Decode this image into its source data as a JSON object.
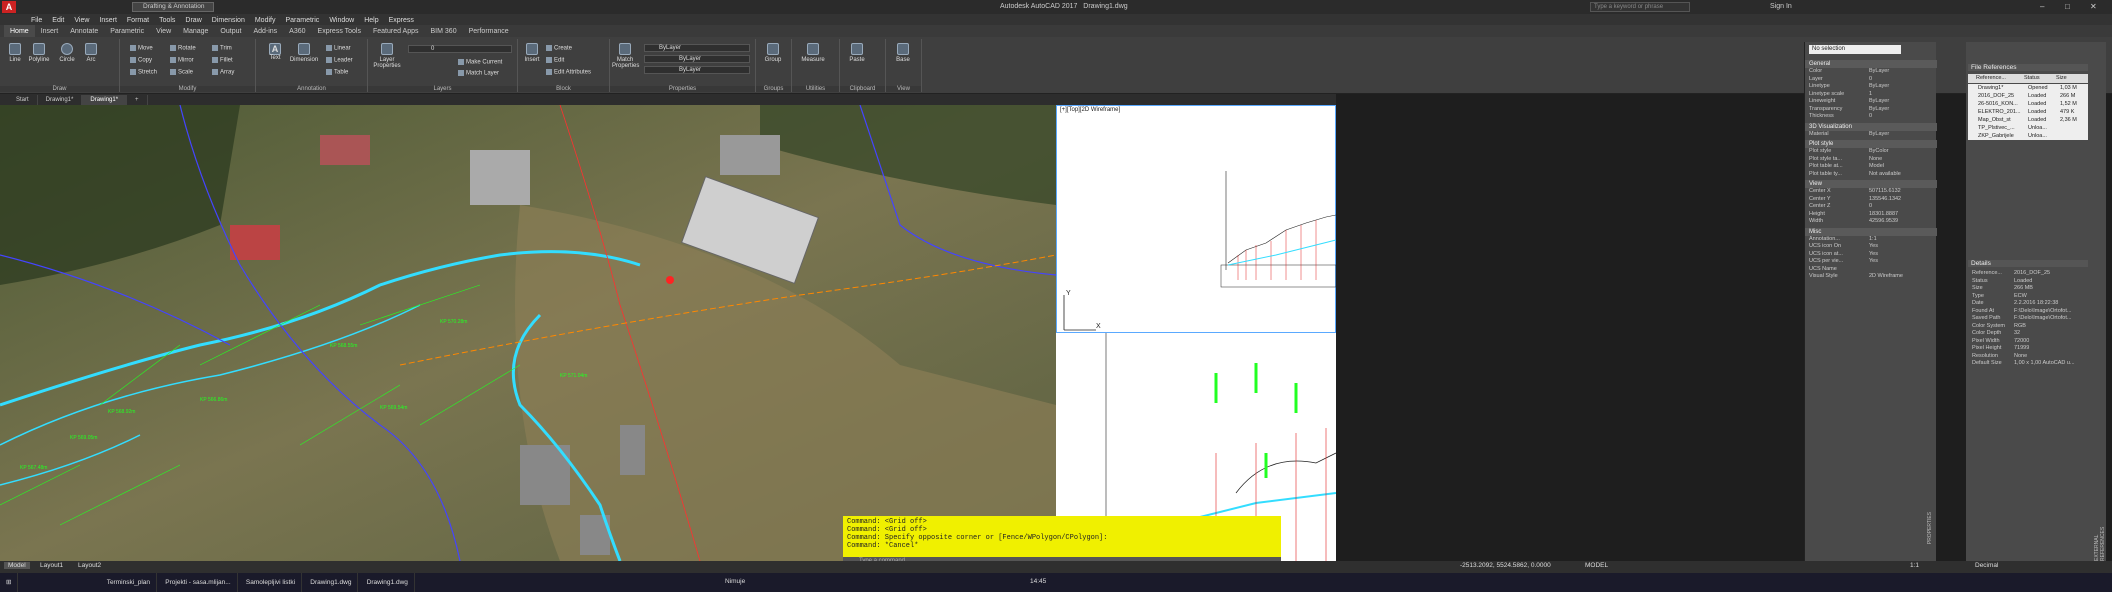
{
  "window": {
    "app_title": "Autodesk AutoCAD 2017",
    "doc_title": "Drawing1.dwg",
    "workspace": "Drafting & Annotation",
    "search_placeholder": "Type a keyword or phrase",
    "sign_in": "Sign In"
  },
  "menu": [
    "File",
    "Edit",
    "View",
    "Insert",
    "Format",
    "Tools",
    "Draw",
    "Dimension",
    "Modify",
    "Parametric",
    "Window",
    "Help",
    "Express"
  ],
  "ribbon_tabs": [
    "Home",
    "Insert",
    "Annotate",
    "Parametric",
    "View",
    "Manage",
    "Output",
    "Add-ins",
    "A360",
    "Express Tools",
    "Featured Apps",
    "BIM 360",
    "Performance"
  ],
  "ribbon": {
    "draw": {
      "label": "Draw",
      "buttons": [
        "Line",
        "Polyline",
        "Circle",
        "Arc"
      ]
    },
    "modify": {
      "label": "Modify",
      "buttons": [
        "Move",
        "Rotate",
        "Trim",
        "Copy",
        "Mirror",
        "Fillet",
        "Stretch",
        "Scale",
        "Array"
      ]
    },
    "annotation": {
      "label": "Annotation",
      "buttons": [
        "Text",
        "Dimension",
        "Linear",
        "Leader",
        "Table"
      ]
    },
    "layers": {
      "label": "Layers",
      "buttons": [
        "Layer Properties",
        "Make Current",
        "Match Layer"
      ],
      "layer_value": "0"
    },
    "block": {
      "label": "Block",
      "buttons": [
        "Insert",
        "Create",
        "Edit",
        "Edit Attributes"
      ]
    },
    "properties": {
      "label": "Properties",
      "buttons": [
        "Match Properties"
      ],
      "color": "ByLayer",
      "linetype": "ByLayer",
      "lineweight": "ByLayer"
    },
    "groups": {
      "label": "Groups",
      "buttons": [
        "Group"
      ]
    },
    "utilities": {
      "label": "Utilities",
      "buttons": [
        "Measure"
      ]
    },
    "clipboard": {
      "label": "Clipboard",
      "buttons": [
        "Paste"
      ]
    },
    "view": {
      "label": "View",
      "buttons": [
        "Base"
      ]
    }
  },
  "doc_tabs": [
    "Start",
    "Drawing1*",
    "Drawing1*"
  ],
  "viewport_label": "[+][Top][2D Wireframe]",
  "map_labels": [
    "KP 568.92m",
    "KP 569.05m",
    "KP 567.48m",
    "KP 566.86m",
    "KP 568.55m",
    "KP 570.28m",
    "KP 571.04m",
    "KP 569.54m"
  ],
  "command_lines": [
    "Command:  <Grid off>",
    "Command:  <Grid off>",
    "Command: Specify opposite corner or [Fence/WPolygon/CPolygon]:",
    "Command: *Cancel*"
  ],
  "command_placeholder": "Type a command",
  "properties_panel": {
    "selection": "No selection",
    "sections": [
      {
        "title": "General",
        "rows": [
          [
            "Color",
            "ByLayer"
          ],
          [
            "Layer",
            "0"
          ],
          [
            "Linetype",
            "ByLayer"
          ],
          [
            "Linetype scale",
            "1"
          ],
          [
            "Lineweight",
            "ByLayer"
          ],
          [
            "Transparency",
            "ByLayer"
          ],
          [
            "Thickness",
            "0"
          ]
        ]
      },
      {
        "title": "3D Visualization",
        "rows": [
          [
            "Material",
            "ByLayer"
          ]
        ]
      },
      {
        "title": "Plot style",
        "rows": [
          [
            "Plot style",
            "ByColor"
          ],
          [
            "Plot style ta...",
            "None"
          ],
          [
            "Plot table at...",
            "Model"
          ],
          [
            "Plot table ty...",
            "Not available"
          ]
        ]
      },
      {
        "title": "View",
        "rows": [
          [
            "Center X",
            "507115.6132"
          ],
          [
            "Center Y",
            "135546.1342"
          ],
          [
            "Center Z",
            "0"
          ],
          [
            "Height",
            "18301.8887"
          ],
          [
            "Width",
            "42596.9539"
          ]
        ]
      },
      {
        "title": "Misc",
        "rows": [
          [
            "Annotation...",
            "1:1"
          ],
          [
            "UCS icon On",
            "Yes"
          ],
          [
            "UCS icon at...",
            "Yes"
          ],
          [
            "UCS per vie...",
            "Yes"
          ],
          [
            "UCS Name",
            ""
          ],
          [
            "Visual Style",
            "2D Wireframe"
          ]
        ]
      }
    ],
    "side_label": "PROPERTIES"
  },
  "xrefs": {
    "title": "File References",
    "columns": [
      "Reference...",
      "Status",
      "Size"
    ],
    "rows": [
      [
        "Drawing1*",
        "Opened",
        "1,03 M"
      ],
      [
        "2016_DOF_25",
        "Loaded",
        "266 M"
      ],
      [
        "26-5016_KON...",
        "Loaded",
        "1,52 M"
      ],
      [
        "ELEKTRO_201...",
        "Loaded",
        "479 K"
      ],
      [
        "Map_Obst_st",
        "Loaded",
        "2,36 M"
      ],
      [
        "TP_Plstivec_...",
        "Unloa...",
        ""
      ],
      [
        "ZKP_Gabrijele",
        "Unloa...",
        ""
      ]
    ],
    "details_title": "Details",
    "details": [
      [
        "Reference...",
        "2016_DOF_25"
      ],
      [
        "Status",
        "Loaded"
      ],
      [
        "Size",
        "266 MB"
      ],
      [
        "Type",
        "ECW"
      ],
      [
        "Date",
        "2.2.2016 18:22:38"
      ],
      [
        "Found At",
        "F:\\Delo\\Image\\Ortofot..."
      ],
      [
        "Saved Path",
        "F:\\Delo\\Image\\Ortofot..."
      ],
      [
        "Color System",
        "RGB"
      ],
      [
        "Color Depth",
        "32"
      ],
      [
        "Pixel Width",
        "72000"
      ],
      [
        "Pixel Height",
        "71999"
      ],
      [
        "Resolution",
        "None"
      ],
      [
        "Default Size",
        "1,00 x 1,00 AutoCAD u..."
      ]
    ],
    "side_label": "EXTERNAL REFERENCES"
  },
  "layout_tabs": [
    "Model",
    "Layout1",
    "Layout2"
  ],
  "status": {
    "coords": "-2513.2092, 5524.5862, 0.0000",
    "mode": "MODEL",
    "units": "Decimal",
    "scale": "1:1"
  },
  "taskbar": {
    "items": [
      "Terminski_plan",
      "Projekti - sasa.mlijan...",
      "Samolepljivi listki",
      "Drawing1.dwg",
      "Drawing1.dwg"
    ],
    "lang": "Nimuje",
    "time": "14:45"
  },
  "colors": {
    "accent": "#f0f000",
    "map_green": "#22ff22",
    "map_cyan": "#33ddff",
    "profile_red": "#e02020"
  }
}
